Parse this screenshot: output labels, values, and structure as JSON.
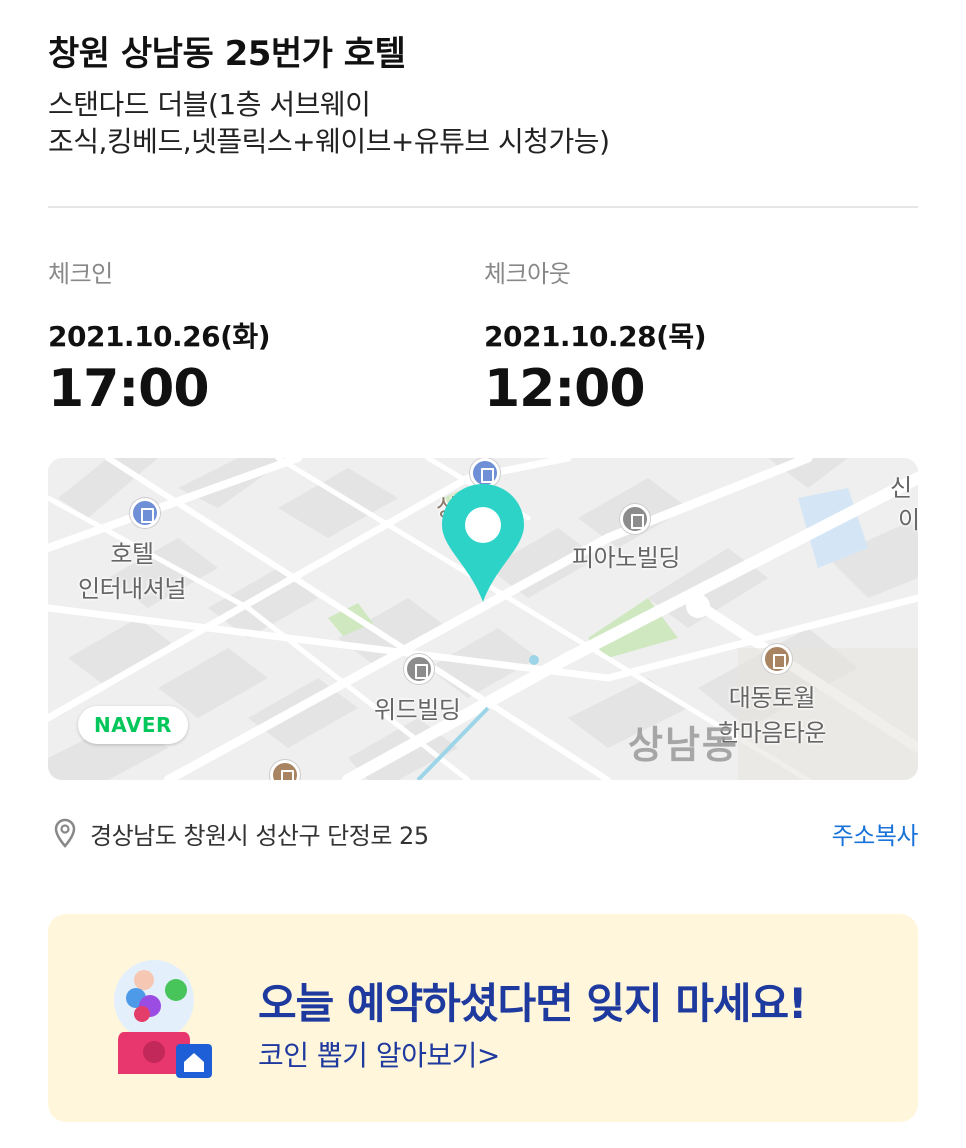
{
  "hotel": {
    "title": "창원 상남동 25번가 호텔",
    "room_line1": "스탠다드 더블(1층 서브웨이",
    "room_line2": "조식,킹베드,넷플릭스+웨이브+유튜브 시청가능)"
  },
  "checkin": {
    "label": "체크인",
    "date": "2021.10.26(화)",
    "time": "17:00"
  },
  "checkout": {
    "label": "체크아웃",
    "date": "2021.10.28(목)",
    "time": "12:00"
  },
  "map": {
    "badge": "NAVER",
    "labels": {
      "hotel_intl_line1": "호텔",
      "hotel_intl_line2": "인터내셔널",
      "piano": "피아노빌딩",
      "wide": "위드빌딩",
      "daedong_line1": "대동토월",
      "daedong_line2": "한마음타운",
      "district": "상남동",
      "top_partial": "상      당",
      "edge_partial_1": "신",
      "edge_partial_2": "이"
    },
    "pin_color": "#2ed3c8"
  },
  "address": {
    "text": "경상남도 창원시 성산구 단정로 25",
    "copy_label": "주소복사"
  },
  "promo": {
    "headline": "오늘 예약하셨다면 잊지 마세요!",
    "sub": "코인 뽑기 알아보기>"
  }
}
